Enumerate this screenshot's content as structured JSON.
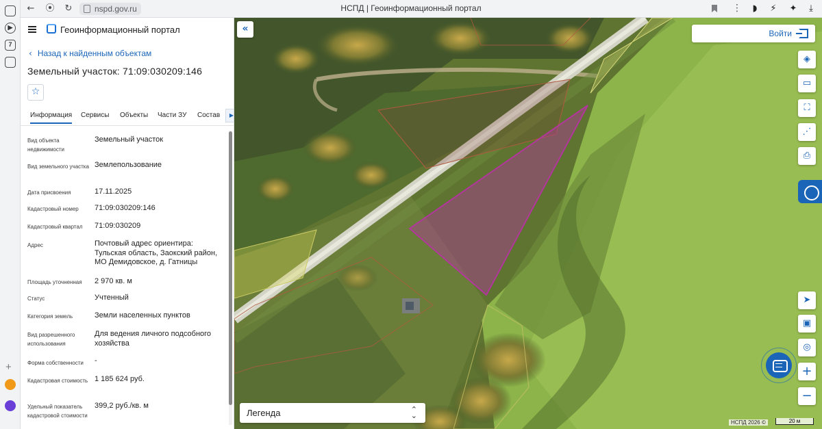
{
  "browser": {
    "url": "nspd.gov.ru",
    "tab_title": "НСПД | Геоинформационный портал"
  },
  "app": {
    "portal_name": "Геоинформационный портал",
    "back_link": "Назад к найденным объектам",
    "object_title": "Земельный участок: 71:09:030209:146"
  },
  "tabs": [
    {
      "label": "Информация"
    },
    {
      "label": "Сервисы"
    },
    {
      "label": "Объекты"
    },
    {
      "label": "Части ЗУ"
    },
    {
      "label": "Состав"
    }
  ],
  "info": [
    {
      "label": "Вид объекта недвижимости",
      "value": "Земельный участок"
    },
    {
      "label": "Вид земельного участка",
      "value": "Землепользование"
    },
    {
      "label": "Дата присвоения",
      "value": "17.11.2025"
    },
    {
      "label": "Кадастровый номер",
      "value": "71:09:030209:146"
    },
    {
      "label": "Кадастровый квартал",
      "value": "71:09:030209"
    },
    {
      "label": "Адрес",
      "value": "Почтовый адрес ориентира: Тульская область, Заокский район, МО Демидовское, д. Гатницы"
    },
    {
      "label": "Площадь уточненная",
      "value": "2 970 кв. м"
    },
    {
      "label": "Статус",
      "value": "Учтенный"
    },
    {
      "label": "Категория земель",
      "value": "Земли населенных пунктов"
    },
    {
      "label": "Вид разрешенного использования",
      "value": "Для ведения личного подсобного хозяйства"
    },
    {
      "label": "Форма собственности",
      "value": "-"
    },
    {
      "label": "Кадастровая стоимость",
      "value": "1 185 624 руб."
    },
    {
      "label": "Удельный показатель кадастровой стоимости",
      "value": "399,2 руб./кв. м"
    }
  ],
  "map": {
    "login_label": "Войти",
    "legend_label": "Легенда",
    "copyright": "НСПД 2026 ©",
    "scale_label": "20 м",
    "parcel_color": "#b2379c",
    "accent": "#1a65b8",
    "tools": [
      "layers-icon",
      "ruler-icon",
      "select-area-icon",
      "share-icon",
      "print-icon",
      "navigate-icon",
      "map-view-icon",
      "locate-icon",
      "zoom-in-icon",
      "zoom-out-icon"
    ]
  }
}
